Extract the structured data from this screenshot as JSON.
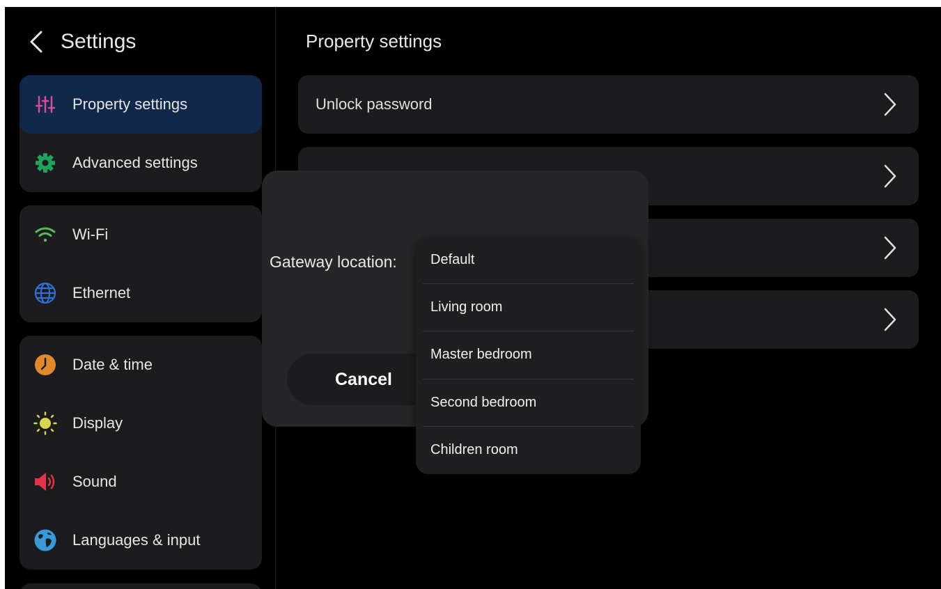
{
  "sidebar": {
    "title": "Settings",
    "groups": [
      {
        "items": [
          {
            "label": "Property settings",
            "icon": "sliders-icon",
            "active": true
          },
          {
            "label": "Advanced settings",
            "icon": "gear-icon"
          }
        ]
      },
      {
        "items": [
          {
            "label": "Wi-Fi",
            "icon": "wifi-icon"
          },
          {
            "label": "Ethernet",
            "icon": "globe-icon"
          }
        ]
      },
      {
        "items": [
          {
            "label": "Date & time",
            "icon": "clock-icon"
          },
          {
            "label": "Display",
            "icon": "sun-icon"
          },
          {
            "label": "Sound",
            "icon": "speaker-icon"
          },
          {
            "label": "Languages & input",
            "icon": "earth-icon"
          }
        ]
      }
    ]
  },
  "main": {
    "title": "Property settings",
    "rows": [
      {
        "label": "Unlock password"
      },
      {
        "label": ""
      },
      {
        "label": ""
      },
      {
        "label": ""
      }
    ]
  },
  "dialog": {
    "label": "Gateway location:",
    "cancel_label": "Cancel",
    "options": [
      "Default",
      "Living room",
      "Master bedroom",
      "Second bedroom",
      "Children room"
    ]
  },
  "colors": {
    "background": "#000000",
    "card": "#1c1c1e",
    "active": "#10284a",
    "dialog": "#262628",
    "sliders": "#d94a9a",
    "gear": "#1fa35c",
    "wifi": "#5cb85c",
    "globe": "#2f6fd6",
    "clock": "#e08a2c",
    "sun": "#d6d64a",
    "speaker": "#e0334a",
    "earth": "#3a9ad9"
  }
}
